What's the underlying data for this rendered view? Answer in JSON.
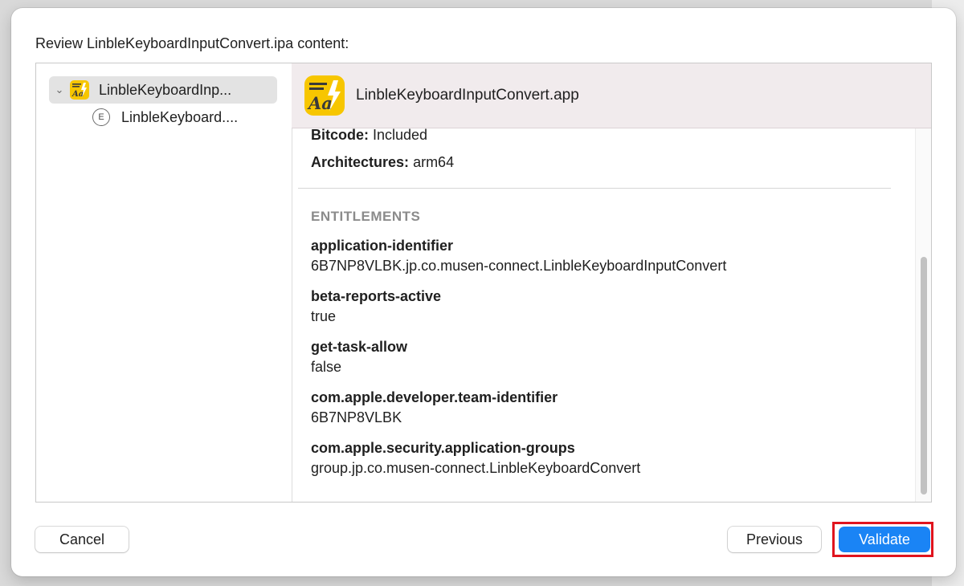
{
  "dialog": {
    "title": "Review LinbleKeyboardInputConvert.ipa content:"
  },
  "sidebar": {
    "items": [
      {
        "label": "LinbleKeyboardInp...",
        "icon": "app-icon",
        "expanded": true,
        "selected": true
      },
      {
        "label": "LinbleKeyboard....",
        "icon": "extension-icon",
        "icon_glyph": "E"
      }
    ]
  },
  "detail": {
    "app_name": "LinbleKeyboardInputConvert.app",
    "fields": [
      {
        "key": "Bitcode:",
        "value": "Included"
      },
      {
        "key": "Architectures:",
        "value": "arm64"
      }
    ],
    "entitlements_heading": "ENTITLEMENTS",
    "entitlements": [
      {
        "key": "application-identifier",
        "value": "6B7NP8VLBK.jp.co.musen-connect.LinbleKeyboardInputConvert"
      },
      {
        "key": "beta-reports-active",
        "value": "true"
      },
      {
        "key": "get-task-allow",
        "value": "false"
      },
      {
        "key": "com.apple.developer.team-identifier",
        "value": "6B7NP8VLBK"
      },
      {
        "key": "com.apple.security.application-groups",
        "value": "group.jp.co.musen-connect.LinbleKeyboardConvert"
      }
    ]
  },
  "buttons": {
    "cancel": "Cancel",
    "previous": "Previous",
    "validate": "Validate"
  },
  "colors": {
    "accent": "#1a84f5",
    "highlight": "#e0141e",
    "app_icon": "#f7c600"
  }
}
